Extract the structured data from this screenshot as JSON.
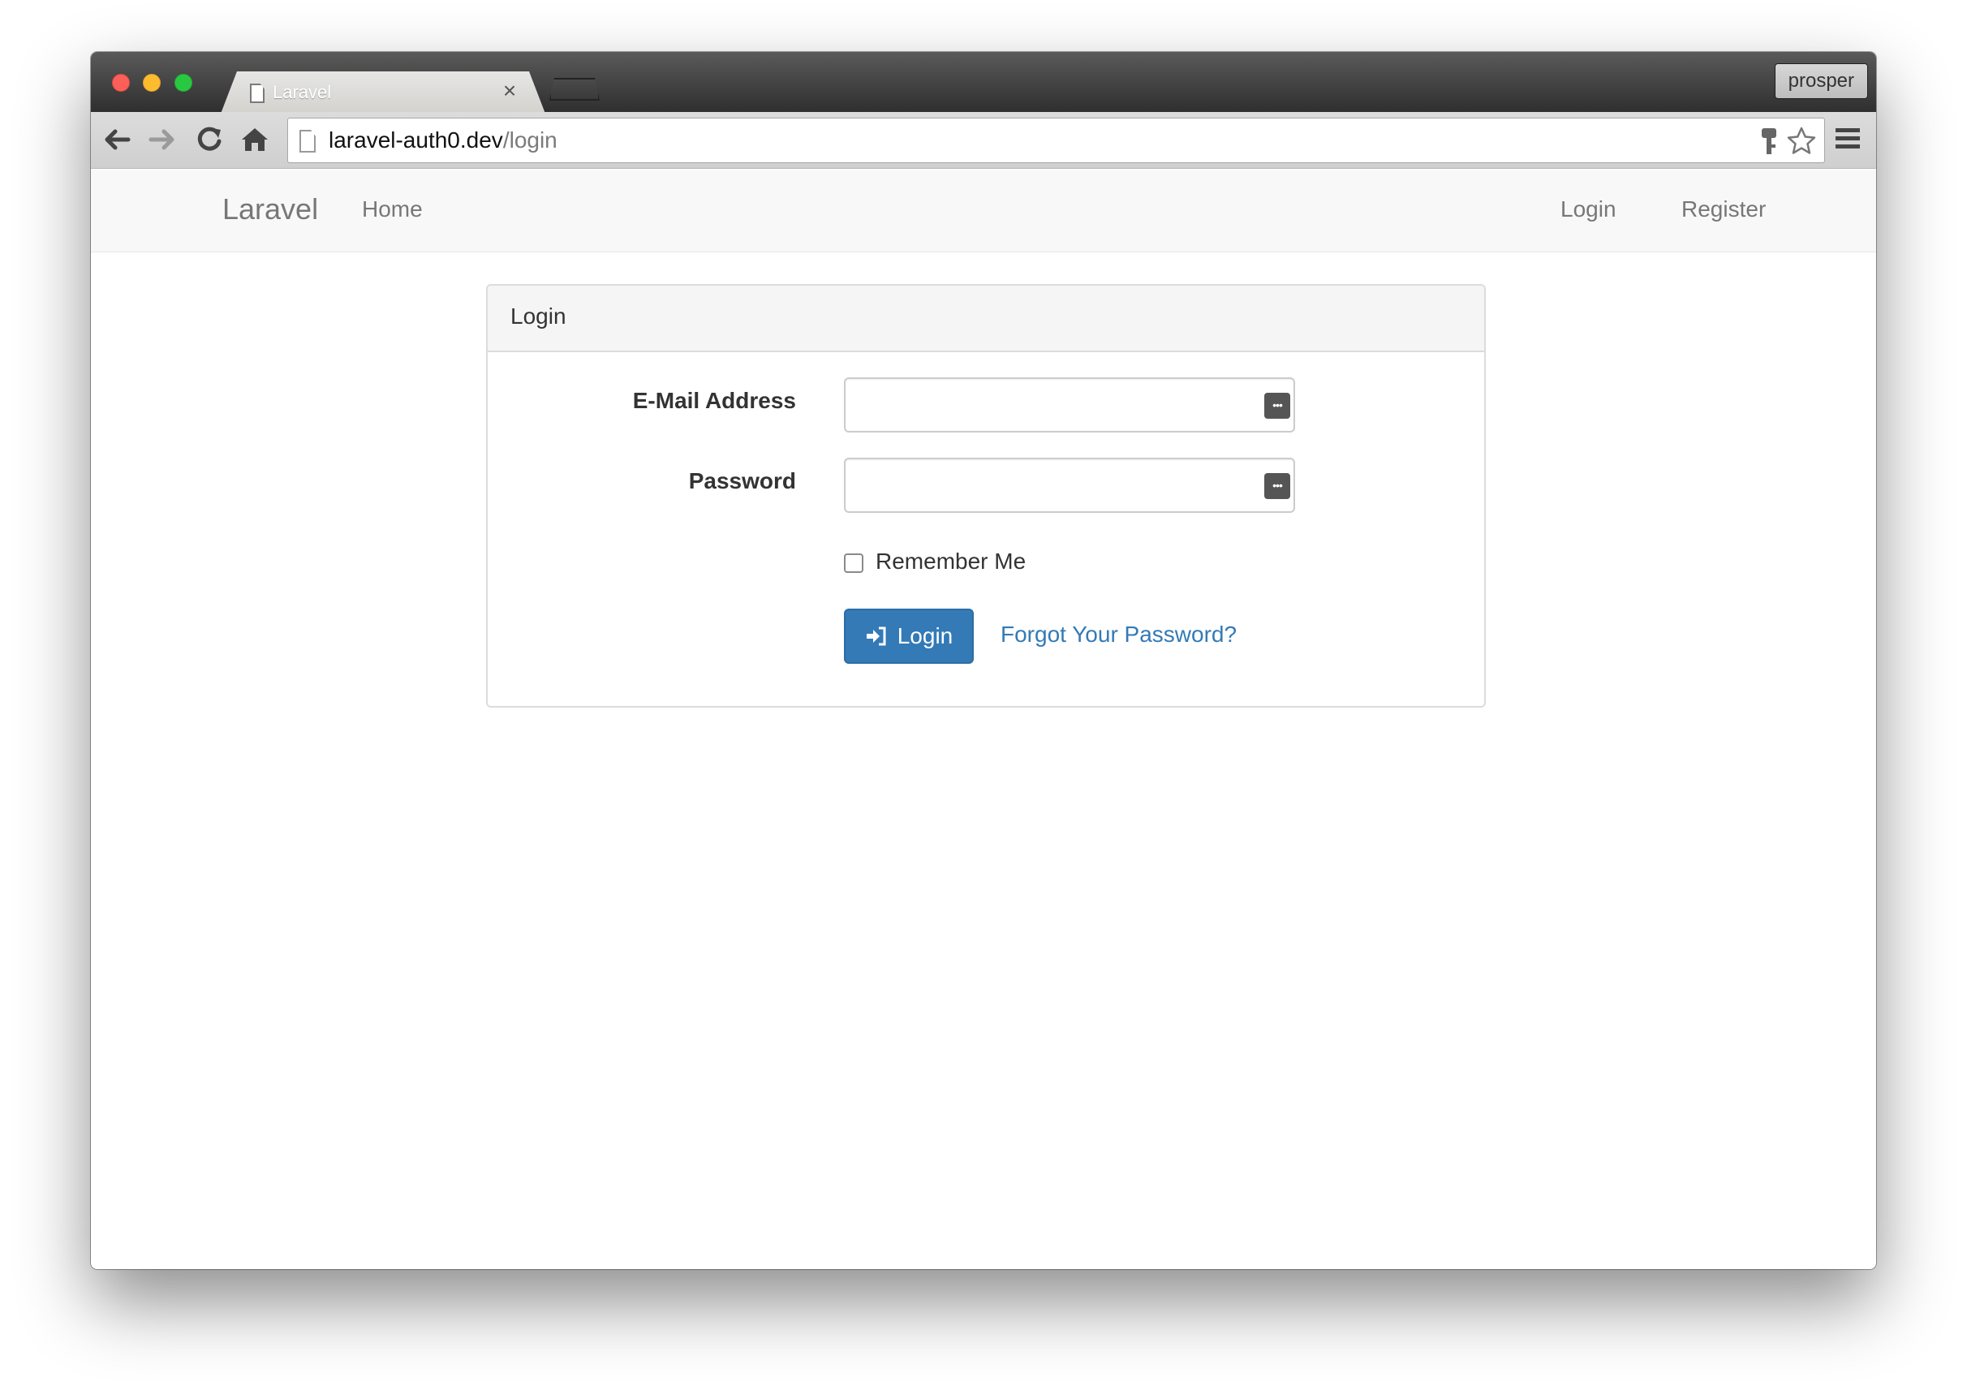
{
  "browser": {
    "tab_title": "Laravel",
    "tab_close": "×",
    "profile_name": "prosper",
    "url_host": "laravel-auth0.dev",
    "url_path": "/login"
  },
  "navbar": {
    "brand": "Laravel",
    "home": "Home",
    "login": "Login",
    "register": "Register"
  },
  "login_panel": {
    "heading": "Login",
    "email_label": "E-Mail Address",
    "email_value": "",
    "password_label": "Password",
    "password_value": "",
    "password_manager_icon": "•••",
    "remember_label": "Remember Me",
    "remember_checked": false,
    "submit_label": "Login",
    "forgot_label": "Forgot Your Password?"
  },
  "colors": {
    "primary": "#337ab7",
    "navbar_bg": "#f8f8f8",
    "panel_heading_bg": "#f5f5f5"
  }
}
